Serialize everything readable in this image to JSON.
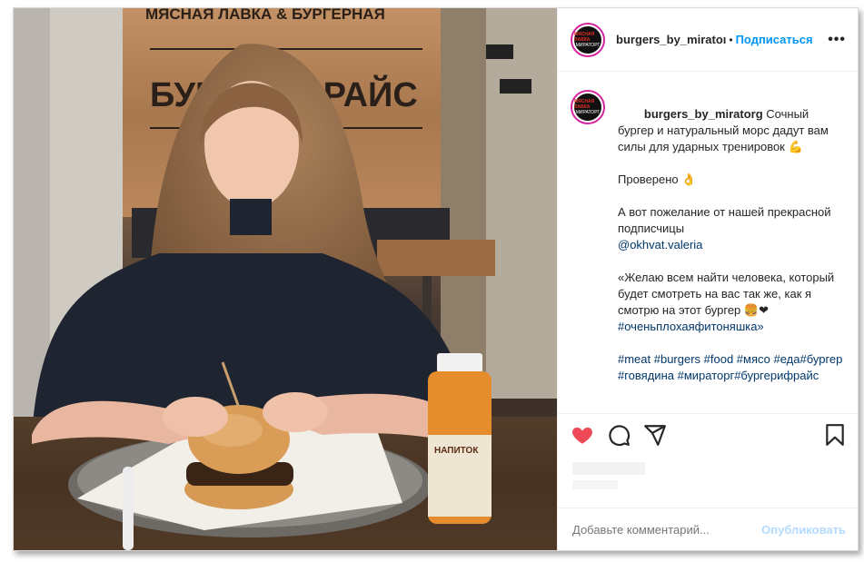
{
  "post": {
    "username": "burgers_by_miratorg",
    "username_short": "burgers_by_miratoı",
    "separator": "•",
    "follow_label": "Подписаться",
    "more_label": "•••",
    "avatar_line1": "МЯСНАЯ ЛАВКА",
    "avatar_line2": "МИРАТОРГ",
    "caption_lines": [
      "Сочный бургер и натуральный морс дадут вам силы для ударных тренировок 💪",
      "",
      "Проверено 👌",
      "",
      "А вот пожелание от нашей прекрасной подписчицы",
      "@okhvat.valeria",
      "",
      "«Желаю всем найти человека, который будет смотреть на вас так же, как я смотрю на этот бургер 🍔❤",
      "#оченьплохаяфитоняшка»",
      "",
      "#meat #burgers #food #мясо #еда#бургер #говядина #мираторг#бургерифрайс"
    ],
    "comment_placeholder": "Добавьте комментарий...",
    "publish_label": "Опубликовать"
  },
  "photo": {
    "sign_top": "МЯСНАЯ ЛАВКА & БУРГЕРНАЯ",
    "sign_main": "БУРГЕР ФРАЙС",
    "bottle_label": "НАПИТОК"
  },
  "colors": {
    "accent": "#0095f6",
    "like": "#ed4956",
    "publish_disabled": "#b3dbff"
  },
  "icons": [
    "heart-icon",
    "comment-icon",
    "share-icon",
    "bookmark-icon",
    "more-icon"
  ]
}
